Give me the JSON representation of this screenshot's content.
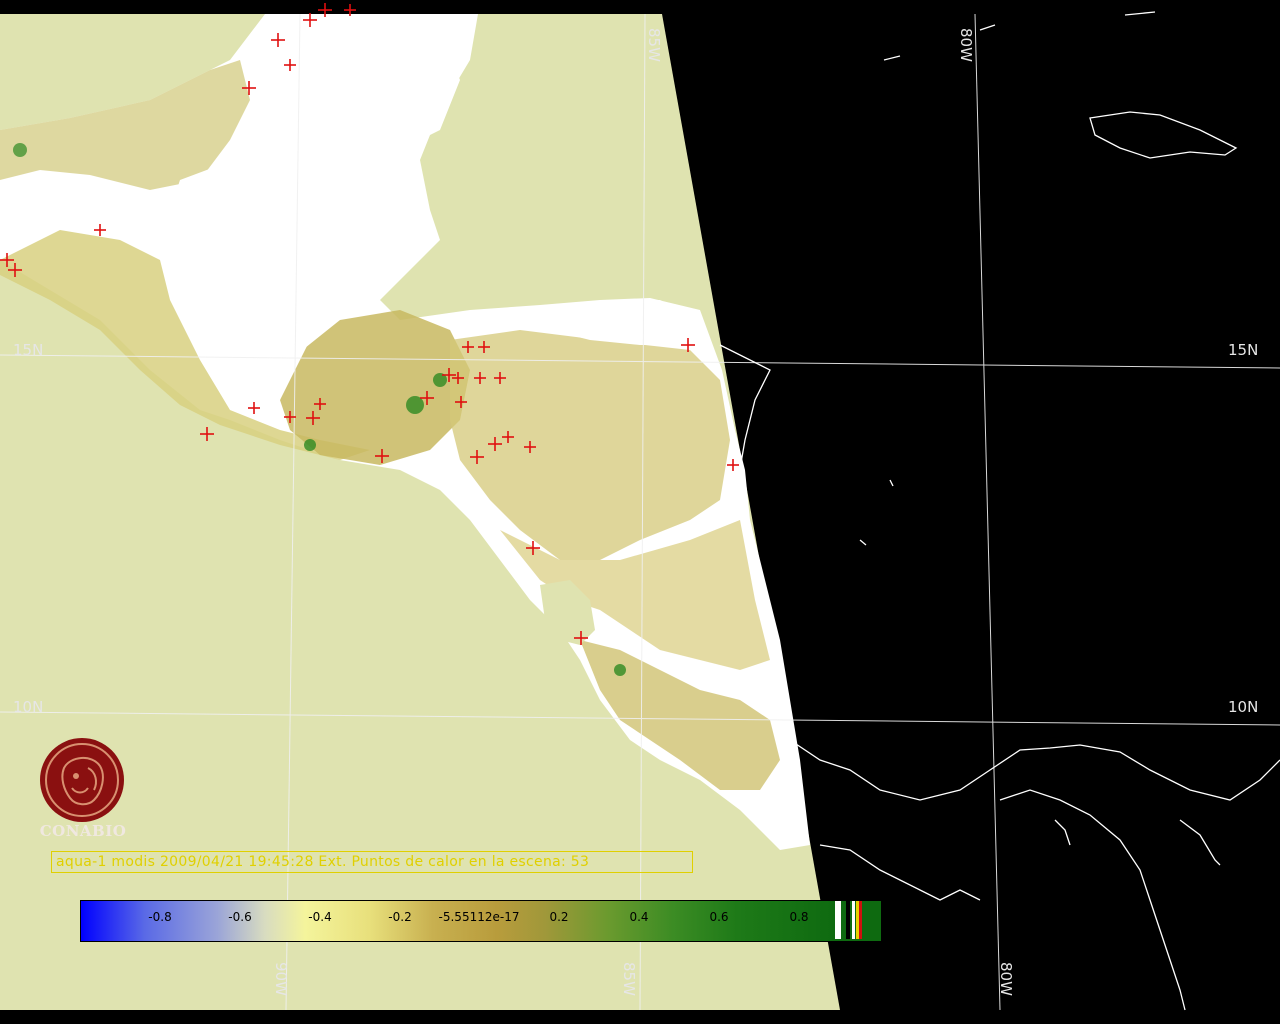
{
  "map": {
    "grid_labels": {
      "lat_15_left": "15N",
      "lat_15_right": "15N",
      "lat_10_left": "10N",
      "lat_10_right": "10N",
      "lon_85_top": "85W",
      "lon_80_top": "80W",
      "lon_90_bottom": "90W",
      "lon_85_bottom": "85W",
      "lon_80_bottom": "80W"
    },
    "caption": "aqua-1 modis 2009/04/21 19:45:28 Ext. Puntos de calor en la escena: 53",
    "logo_text": "CONABIO",
    "colors": {
      "ocean": "#dfe3b0",
      "outside_swath": "#000000",
      "hotspot": "#e01010",
      "coastline": "#ffffff",
      "gridline": "#f0f0f0",
      "caption": "#e0d000"
    },
    "colorbar": {
      "ticks": [
        "-0.8",
        "-0.6",
        "-0.4",
        "-0.2",
        "-5.55112e-17",
        "0.2",
        "0.4",
        "0.6",
        "0.8"
      ]
    }
  }
}
